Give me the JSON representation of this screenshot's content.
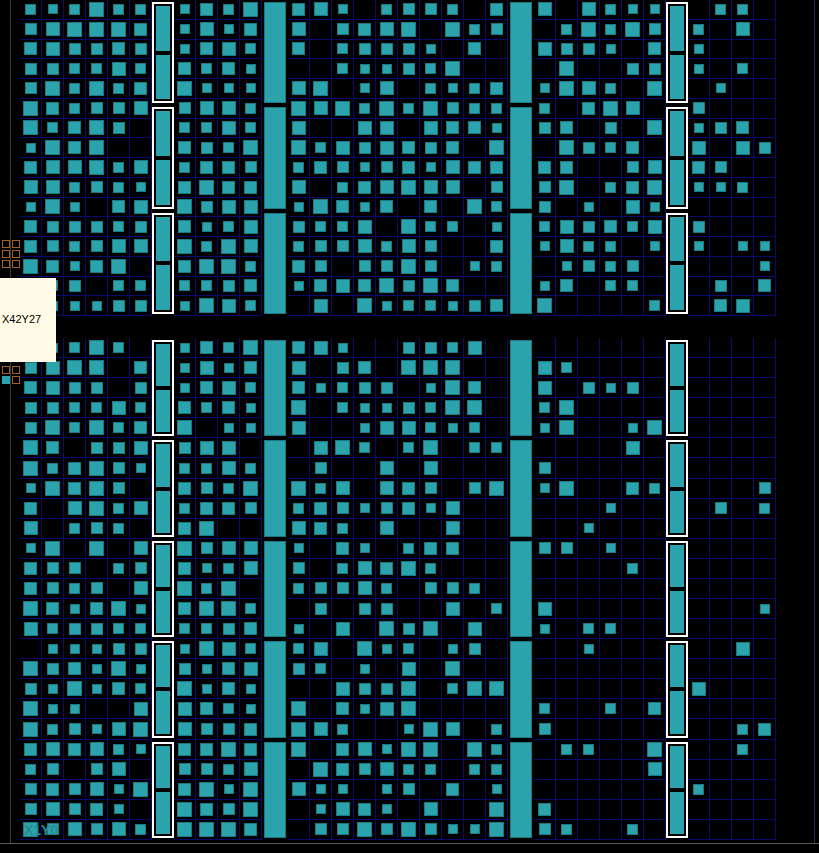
{
  "tooltip": {
    "text": "X42Y27"
  },
  "region_label": "X1Y0",
  "columns": [
    {
      "kind": "clb",
      "level_top": 0.95,
      "level_bottom": 0.92
    },
    {
      "kind": "clb",
      "level_top": 0.95,
      "level_bottom": 0.9
    },
    {
      "kind": "clb",
      "level_top": 0.93,
      "level_bottom": 0.9
    },
    {
      "kind": "clb",
      "level_top": 0.95,
      "level_bottom": 0.92
    },
    {
      "kind": "clb",
      "level_top": 0.92,
      "level_bottom": 0.88
    },
    {
      "kind": "clb",
      "level_top": 0.9,
      "level_bottom": 0.85
    },
    {
      "kind": "bram",
      "level_top": 1,
      "level_bottom": 1
    },
    {
      "kind": "clb",
      "level_top": 0.97,
      "level_bottom": 0.95
    },
    {
      "kind": "clb",
      "level_top": 0.95,
      "level_bottom": 0.95
    },
    {
      "kind": "clb",
      "level_top": 0.95,
      "level_bottom": 0.93
    },
    {
      "kind": "clb",
      "level_top": 0.9,
      "level_bottom": 0.9
    },
    {
      "kind": "dsp",
      "level_top": 1,
      "level_bottom": 1
    },
    {
      "kind": "clb",
      "level_top": 0.85,
      "level_bottom": 0.8
    },
    {
      "kind": "clb",
      "level_top": 0.75,
      "level_bottom": 0.8
    },
    {
      "kind": "clb",
      "level_top": 0.8,
      "level_bottom": 0.85
    },
    {
      "kind": "clb",
      "level_top": 0.85,
      "level_bottom": 0.8
    },
    {
      "kind": "clb",
      "level_top": 0.8,
      "level_bottom": 0.75
    },
    {
      "kind": "clb",
      "level_top": 0.85,
      "level_bottom": 0.7
    },
    {
      "kind": "clb",
      "level_top": 0.8,
      "level_bottom": 0.65
    },
    {
      "kind": "clb",
      "level_top": 0.8,
      "level_bottom": 0.6
    },
    {
      "kind": "clb",
      "level_top": 0.75,
      "level_bottom": 0.55
    },
    {
      "kind": "clb",
      "level_top": 0.75,
      "level_bottom": 0.5
    },
    {
      "kind": "dsp",
      "level_top": 1,
      "level_bottom": 1
    },
    {
      "kind": "clb",
      "level_top": 0.8,
      "level_bottom": 0.5
    },
    {
      "kind": "clb",
      "level_top": 0.75,
      "level_bottom": 0.35
    },
    {
      "kind": "clb",
      "level_top": 0.75,
      "level_bottom": 0.3
    },
    {
      "kind": "clb",
      "level_top": 0.7,
      "level_bottom": 0.25
    },
    {
      "kind": "clb",
      "level_top": 0.7,
      "level_bottom": 0.3
    },
    {
      "kind": "clb",
      "level_top": 0.65,
      "level_bottom": 0.25
    },
    {
      "kind": "bram",
      "level_top": 1,
      "level_bottom": 1
    },
    {
      "kind": "clb",
      "level_top": 0.6,
      "level_bottom": 0.1
    },
    {
      "kind": "clb",
      "level_top": 0.55,
      "level_bottom": 0.05
    },
    {
      "kind": "clb",
      "level_top": 0.5,
      "level_bottom": 0.15
    },
    {
      "kind": "clb",
      "level_top": 0.35,
      "level_bottom": 0.1
    }
  ]
}
